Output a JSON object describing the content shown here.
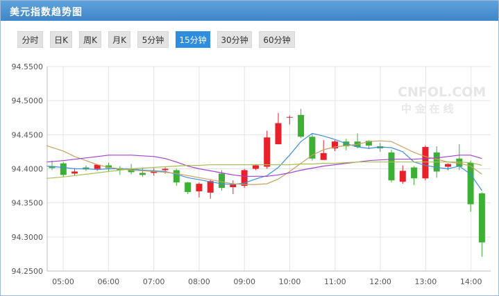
{
  "header": {
    "title": "美元指数趋势图"
  },
  "tabs": [
    {
      "label": "分时"
    },
    {
      "label": "日K"
    },
    {
      "label": "周K"
    },
    {
      "label": "月K"
    },
    {
      "label": "5分钟"
    },
    {
      "label": "15分钟",
      "active": true
    },
    {
      "label": "30分钟"
    },
    {
      "label": "60分钟"
    }
  ],
  "watermark": {
    "top": "CNFOL.COM",
    "bottom": "中 金 在 线"
  },
  "colors": {
    "up": "#e8202a",
    "down": "#3cb034",
    "ma5": "#3d8fe0",
    "ma10": "#c8a060",
    "ma20": "#a53fd0",
    "ma30": "#a8c050",
    "grid": "#e4e4e4",
    "axis_text": "#555555"
  },
  "chart_data": {
    "type": "candlestick",
    "ylim": [
      94.25,
      94.55
    ],
    "yticks": [
      "94.5500",
      "94.5000",
      "94.4500",
      "94.4000",
      "94.3500",
      "94.3000",
      "94.2500"
    ],
    "xticks": [
      "05:00",
      "06:00",
      "07:00",
      "08:00",
      "09:00",
      "10:00",
      "11:00",
      "12:00",
      "13:00",
      "14:00"
    ],
    "candles": [
      {
        "o": 94.404,
        "h": 94.412,
        "l": 94.398,
        "c": 94.401
      },
      {
        "o": 94.408,
        "h": 94.41,
        "l": 94.388,
        "c": 94.391
      },
      {
        "o": 94.393,
        "h": 94.401,
        "l": 94.39,
        "c": 94.396
      },
      {
        "o": 94.402,
        "h": 94.405,
        "l": 94.397,
        "c": 94.399
      },
      {
        "o": 94.4,
        "h": 94.407,
        "l": 94.397,
        "c": 94.406
      },
      {
        "o": 94.405,
        "h": 94.409,
        "l": 94.395,
        "c": 94.401
      },
      {
        "o": 94.401,
        "h": 94.404,
        "l": 94.391,
        "c": 94.398
      },
      {
        "o": 94.4,
        "h": 94.407,
        "l": 94.392,
        "c": 94.395
      },
      {
        "o": 94.394,
        "h": 94.402,
        "l": 94.388,
        "c": 94.391
      },
      {
        "o": 94.394,
        "h": 94.401,
        "l": 94.39,
        "c": 94.397
      },
      {
        "o": 94.398,
        "h": 94.402,
        "l": 94.393,
        "c": 94.4
      },
      {
        "o": 94.398,
        "h": 94.4,
        "l": 94.375,
        "c": 94.38
      },
      {
        "o": 94.38,
        "h": 94.381,
        "l": 94.363,
        "c": 94.366
      },
      {
        "o": 94.367,
        "h": 94.38,
        "l": 94.358,
        "c": 94.378
      },
      {
        "o": 94.365,
        "h": 94.384,
        "l": 94.356,
        "c": 94.382
      },
      {
        "o": 94.393,
        "h": 94.398,
        "l": 94.368,
        "c": 94.372
      },
      {
        "o": 94.373,
        "h": 94.383,
        "l": 94.363,
        "c": 94.377
      },
      {
        "o": 94.375,
        "h": 94.4,
        "l": 94.372,
        "c": 94.398
      },
      {
        "o": 94.4,
        "h": 94.406,
        "l": 94.398,
        "c": 94.405
      },
      {
        "o": 94.403,
        "h": 94.456,
        "l": 94.4,
        "c": 94.446
      },
      {
        "o": 94.436,
        "h": 94.482,
        "l": 94.436,
        "c": 94.467
      },
      {
        "o": 94.475,
        "h": 94.478,
        "l": 94.465,
        "c": 94.476
      },
      {
        "o": 94.479,
        "h": 94.488,
        "l": 94.445,
        "c": 94.447
      },
      {
        "o": 94.447,
        "h": 94.452,
        "l": 94.412,
        "c": 94.415
      },
      {
        "o": 94.413,
        "h": 94.442,
        "l": 94.413,
        "c": 94.423
      },
      {
        "o": 94.43,
        "h": 94.442,
        "l": 94.426,
        "c": 94.44
      },
      {
        "o": 94.44,
        "h": 94.444,
        "l": 94.427,
        "c": 94.433
      },
      {
        "o": 94.44,
        "h": 94.452,
        "l": 94.43,
        "c": 94.432
      },
      {
        "o": 94.441,
        "h": 94.442,
        "l": 94.429,
        "c": 94.434
      },
      {
        "o": 94.433,
        "h": 94.438,
        "l": 94.425,
        "c": 94.43
      },
      {
        "o": 94.424,
        "h": 94.428,
        "l": 94.38,
        "c": 94.383
      },
      {
        "o": 94.381,
        "h": 94.405,
        "l": 94.378,
        "c": 94.397
      },
      {
        "o": 94.402,
        "h": 94.404,
        "l": 94.376,
        "c": 94.386
      },
      {
        "o": 94.386,
        "h": 94.434,
        "l": 94.383,
        "c": 94.432
      },
      {
        "o": 94.424,
        "h": 94.433,
        "l": 94.387,
        "c": 94.396
      },
      {
        "o": 94.403,
        "h": 94.408,
        "l": 94.398,
        "c": 94.407
      },
      {
        "o": 94.415,
        "h": 94.436,
        "l": 94.398,
        "c": 94.403
      },
      {
        "o": 94.409,
        "h": 94.412,
        "l": 94.337,
        "c": 94.348
      },
      {
        "o": 94.364,
        "h": 94.365,
        "l": 94.271,
        "c": 94.292
      }
    ],
    "lines": [
      {
        "name": "ma5",
        "values": [
          94.404,
          94.402,
          94.4,
          94.4,
          94.399,
          94.4,
          94.4,
          94.4,
          94.398,
          94.397,
          94.396,
          94.392,
          94.387,
          94.384,
          94.381,
          94.378,
          94.377,
          94.379,
          94.385,
          94.39,
          94.402,
          94.42,
          94.44,
          94.452,
          94.448,
          94.443,
          94.437,
          94.432,
          94.43,
          94.432,
          94.431,
          94.425,
          94.41,
          94.405,
          94.402,
          94.4,
          94.404,
          94.392,
          94.368
        ]
      },
      {
        "name": "ma10",
        "values": [
          94.434,
          94.426,
          94.418,
          94.412,
          94.406,
          94.402,
          94.4,
          94.398,
          94.397,
          94.396,
          94.395,
          94.393,
          94.39,
          94.387,
          94.384,
          94.381,
          94.378,
          94.377,
          94.377,
          94.378,
          94.385,
          94.396,
          94.408,
          94.42,
          94.428,
          94.432,
          94.434,
          94.436,
          94.44,
          94.441,
          94.44,
          94.432,
          94.424,
          94.418,
          94.414,
          94.41,
          94.408,
          94.404,
          94.392
        ]
      },
      {
        "name": "ma20",
        "values": [
          94.41,
          94.412,
          94.414,
          94.416,
          94.418,
          94.42,
          94.42,
          94.42,
          94.419,
          94.418,
          94.415,
          94.41,
          94.404,
          94.4,
          94.397,
          94.394,
          94.391,
          94.389,
          94.389,
          94.389,
          94.391,
          94.394,
          94.398,
          94.401,
          94.404,
          94.406,
          94.408,
          94.41,
          94.412,
          94.413,
          94.414,
          94.414,
          94.414,
          94.415,
          94.416,
          94.418,
          94.42,
          94.42,
          94.415
        ]
      },
      {
        "name": "ma30",
        "values": [
          94.386,
          94.388,
          94.39,
          94.392,
          94.394,
          94.396,
          94.398,
          94.4,
          94.401,
          94.402,
          94.403,
          94.404,
          94.405,
          94.405,
          94.406,
          94.406,
          94.406,
          94.406,
          94.406,
          94.406,
          94.406,
          94.406,
          94.407,
          94.407,
          94.408,
          94.408,
          94.409,
          94.41,
          94.41,
          94.41,
          94.41,
          94.41,
          94.41,
          94.41,
          94.41,
          94.41,
          94.41,
          94.409,
          94.405
        ]
      }
    ]
  }
}
